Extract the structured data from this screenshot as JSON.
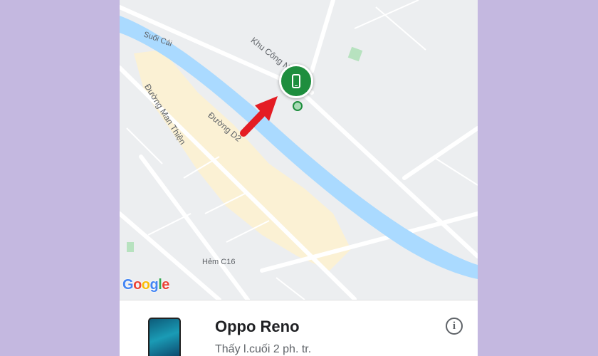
{
  "map": {
    "streets": {
      "suoi_cai": "Suối Cái",
      "khu_cong_nghe": "Khu Công N",
      "duong_man_thien": "Đường Man Thiện",
      "duong_d2": "Đường D2",
      "hem_c16": "Hẻm C16"
    },
    "attribution": {
      "g1": "G",
      "o1": "o",
      "o2": "o",
      "g2": "g",
      "l": "l",
      "e": "e"
    },
    "marker_icon": "smartphone-icon",
    "annotation_arrow_color": "#e41c23",
    "river_color": "#aadaff",
    "marker_color": "#1e8e3e"
  },
  "device_card": {
    "name": "Oppo Reno",
    "last_seen": "Thấy l.cuối 2 ph. tr.",
    "info_icon": "info-icon",
    "info_label": "i"
  }
}
